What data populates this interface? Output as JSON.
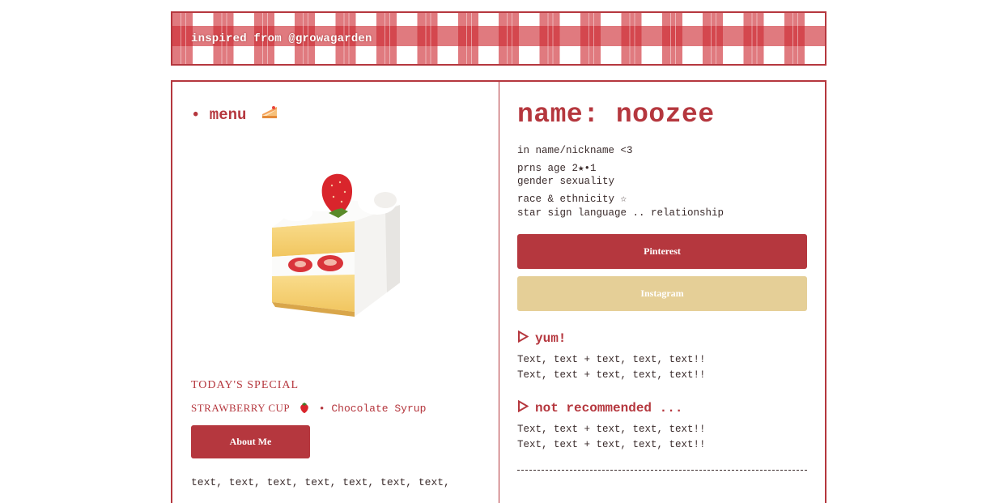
{
  "banner": {
    "text": "inspired from @growagarden"
  },
  "menu": {
    "title": "• menu",
    "icon": "cake-slice-icon",
    "image": "strawberry-shortcake-slice",
    "special_title": "TODAY'S SPECIAL",
    "special_item": "STRAWBERRY CUP",
    "special_item_icon": "strawberry-icon",
    "special_extra": "• Chocolate Syrup",
    "about_button": "About Me",
    "body_text": "text, text, text, text, text, text, text,"
  },
  "profile": {
    "name": "name: noozee",
    "lines": [
      "in name/nickname <3",
      "prns age 2★•1",
      "gender sexuality",
      "race & ethnicity ☆",
      "star sign language .. relationship"
    ]
  },
  "links": {
    "pinterest": "Pinterest",
    "instagram": "Instagram"
  },
  "sections": {
    "yum": {
      "heading": "yum!",
      "lines": [
        "Text, text + text, text, text!!",
        "Text, text + text, text, text!!"
      ]
    },
    "not_recommended": {
      "heading": "not recommended ...",
      "lines": [
        "Text, text + text, text, text!!",
        "Text, text + text, text, text!!"
      ]
    }
  },
  "colors": {
    "accent": "#b5373e",
    "gold": "#e5cf97",
    "text": "#3a2b2b"
  }
}
